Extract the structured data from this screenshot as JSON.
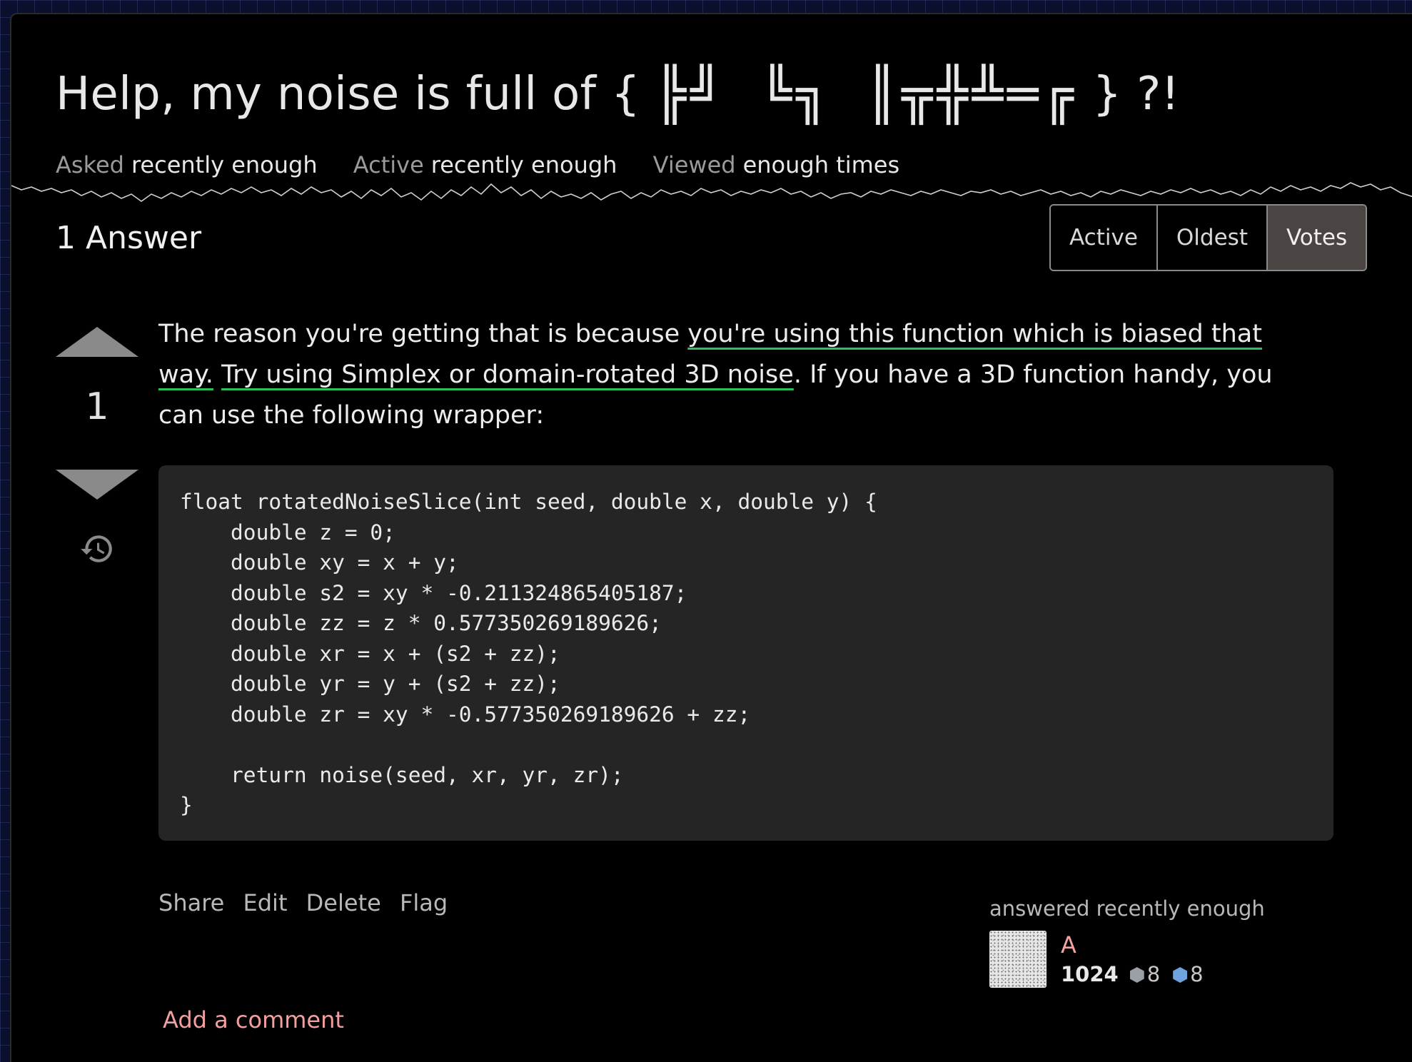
{
  "question": {
    "title_prefix": "Help, my noise is full of {",
    "title_glyphs": "╠╝ ╚╗ ║╦╬╩═╔",
    "title_suffix": "} ?!",
    "meta": [
      {
        "label": "Asked",
        "value": "recently enough"
      },
      {
        "label": "Active",
        "value": "recently enough"
      },
      {
        "label": "Viewed",
        "value": "enough times"
      }
    ]
  },
  "answers_header": {
    "count_label": "1 Answer",
    "sort_options": [
      "Active",
      "Oldest",
      "Votes"
    ],
    "selected_sort": "Votes"
  },
  "answer": {
    "score": "1",
    "text_1": "The reason you're getting that is because ",
    "link_1": "you're using this function which is biased that way.",
    "text_2": " ",
    "link_2": "Try using Simplex or domain-rotated 3D noise",
    "text_3": ". If you have a 3D function handy, you can use the following wrapper:",
    "code": "float rotatedNoiseSlice(int seed, double x, double y) {\n    double z = 0;\n    double xy = x + y;\n    double s2 = xy * -0.211324865405187;\n    double zz = z * 0.577350269189626;\n    double xr = x + (s2 + zz);\n    double yr = y + (s2 + zz);\n    double zr = xy * -0.577350269189626 + zz;\n\n    return noise(seed, xr, yr, zr);\n}",
    "menu": {
      "share": "Share",
      "edit": "Edit",
      "delete": "Delete",
      "flag": "Flag"
    },
    "answered_label": "answered recently enough",
    "user": {
      "name": "A",
      "reputation": "1024",
      "silver_badges": "8",
      "bronze_badges": "8"
    },
    "add_comment": "Add a comment"
  },
  "colors": {
    "link_underline": "#2fbf5a",
    "user_name": "#f4a3a3",
    "add_comment": "#f0a0a0",
    "selected_sort_bg": "#4a4542",
    "code_bg": "#252525"
  }
}
